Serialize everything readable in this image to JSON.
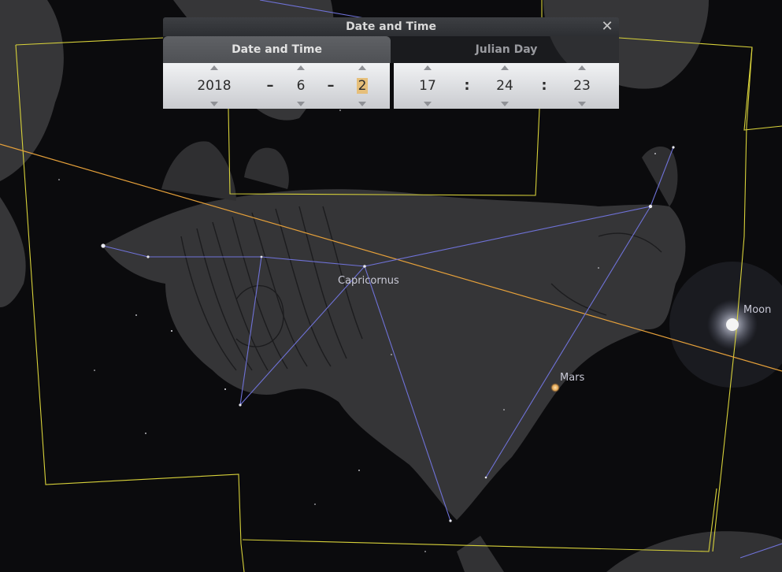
{
  "dialog": {
    "title": "Date and Time",
    "close_glyph": "✕",
    "tabs": [
      {
        "label": "Date and Time",
        "active": true
      },
      {
        "label": "Julian Day",
        "active": false
      }
    ],
    "date": {
      "year": "2018",
      "month": "6",
      "day": "2",
      "separator": "–"
    },
    "time": {
      "hour": "17",
      "minute": "24",
      "second": "23",
      "separator": ":"
    },
    "selected_field": "day",
    "highlight_color": "#e6bf7a"
  },
  "sky": {
    "constellation_label": "Capricornus",
    "objects": [
      {
        "name": "Moon"
      },
      {
        "name": "Mars"
      }
    ],
    "colors": {
      "boundary": "#d8d23a",
      "ecliptic": "#e5a03a",
      "constellation_lines": "#6f72d8",
      "mars": "#f0b76a",
      "moon": "#f4f4f4"
    }
  }
}
